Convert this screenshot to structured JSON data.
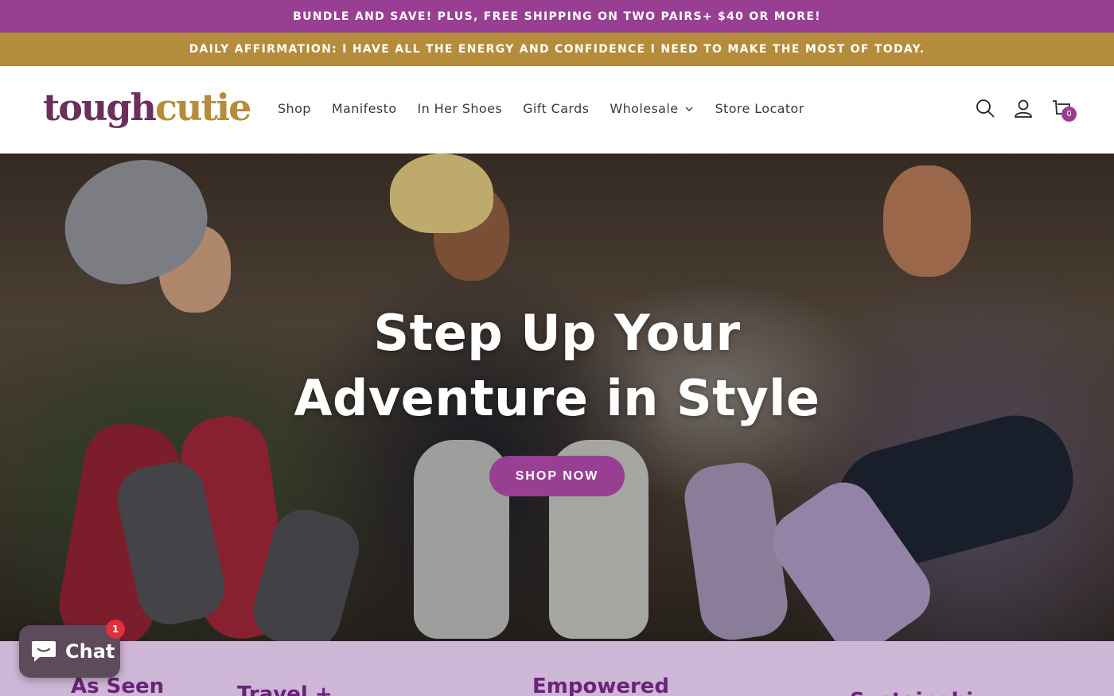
{
  "announcement": {
    "bundle_text": "BUNDLE AND SAVE! PLUS, FREE SHIPPING ON TWO PAIRS+ $40 OR MORE!",
    "affirmation_text": "DAILY AFFIRMATION: I HAVE ALL THE ENERGY AND CONFIDENCE I NEED TO MAKE THE MOST OF TODAY."
  },
  "header": {
    "logo_part1": "tough",
    "logo_part2": "cutie",
    "nav": [
      {
        "label": "Shop"
      },
      {
        "label": "Manifesto"
      },
      {
        "label": "In Her Shoes"
      },
      {
        "label": "Gift Cards"
      },
      {
        "label": "Wholesale",
        "has_dropdown": true
      },
      {
        "label": "Store Locator"
      }
    ],
    "icons": [
      "search-icon",
      "account-icon",
      "cart-icon"
    ],
    "cart_count": "0"
  },
  "hero": {
    "title_line1": "Step Up Your",
    "title_line2": "Adventure in Style",
    "cta_label": "SHOP NOW"
  },
  "features_band": {
    "headings": [
      "As Seen",
      "Travel +",
      "Empowered",
      "Sustainabi..."
    ]
  },
  "chat_widget": {
    "label": "Chat",
    "badge_count": "1"
  },
  "colors": {
    "brand_purple": "#983f93",
    "brand_gold": "#b58c3c",
    "logo_plum": "#6b2f5c",
    "band_lavender": "#cdb6d6"
  }
}
